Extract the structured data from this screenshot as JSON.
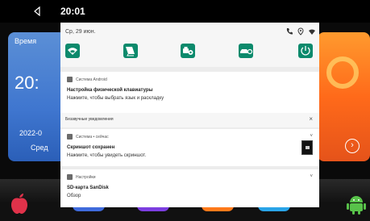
{
  "statusbar": {
    "time": "20:01"
  },
  "launcher": {
    "weather": {
      "title": "Время",
      "big": "20:",
      "date": "2022-0",
      "day": "Сред"
    },
    "colors": {
      "weather": "#3f76cf",
      "right": "#ff6a1a"
    }
  },
  "shade": {
    "date": "Ср, 29 июн.",
    "tiles": [
      {
        "icon": "wifi-icon"
      },
      {
        "icon": "satellite-dish-icon"
      },
      {
        "icon": "car-settings-icon"
      },
      {
        "icon": "car-key-icon"
      },
      {
        "icon": "power-icon"
      }
    ],
    "notification1": {
      "app": "Система Android",
      "title": "Настройка физической клавиатуры",
      "body": "Нажмите, чтобы выбрать язык и раскладку"
    },
    "silent": {
      "label": "Беззвучные уведомления",
      "close": "×"
    },
    "notification2": {
      "app": "Система • сейчас",
      "title": "Скриншот сохранен",
      "body": "Нажмите, чтобы увидеть скриншот."
    },
    "notification3": {
      "app": "Настройки",
      "title": "SD-карта SanDisk",
      "body": "Обзор"
    }
  },
  "accent": "#0c8a6c"
}
